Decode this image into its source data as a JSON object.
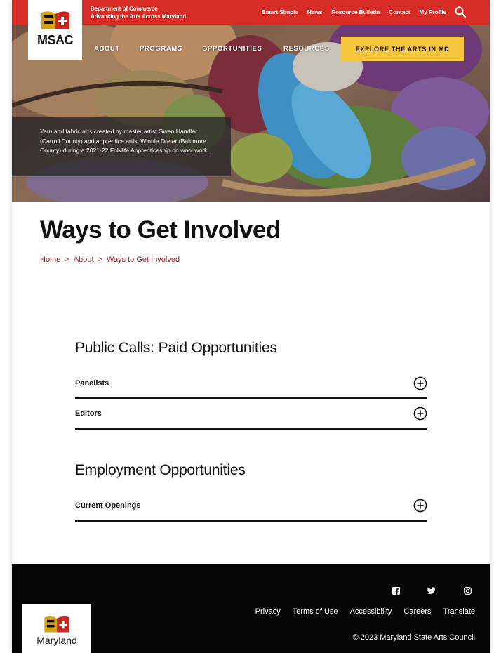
{
  "header": {
    "dept_line1": "Department of Commerce",
    "dept_line2": "Advancing the Arts Across Maryland",
    "utility_links": [
      "Smart Simple",
      "News",
      "Resource Bulletin",
      "Contact",
      "My Profile"
    ],
    "logo_text": "MSAC",
    "nav": [
      "ABOUT",
      "PROGRAMS",
      "OPPORTUNITIES",
      "RESOURCES"
    ],
    "cta_label": "EXPLORE THE ARTS IN MD",
    "colors": {
      "topbar": "#d72b25",
      "cta": "#f5c53b"
    }
  },
  "hero": {
    "caption": "Yarn and fabric arts created by master artist Gwen Handler (Carroll County) and apprentice artist Winnie Dreier (Baltimore County) during a 2021-22 Folklife Apprenticeship on wool work."
  },
  "main": {
    "title": "Ways to Get Involved",
    "breadcrumb": [
      "Home",
      "About",
      "Ways to Get Involved"
    ],
    "breadcrumb_sep": ">",
    "sections": [
      {
        "heading": "Public Calls: Paid Opportunities",
        "items": [
          "Panelists",
          "Editors"
        ]
      },
      {
        "heading": "Employment Opportunities",
        "items": [
          "Current Openings"
        ]
      }
    ],
    "accent": "#a01c1f"
  },
  "footer": {
    "social_icons": [
      "facebook-icon",
      "twitter-icon",
      "instagram-icon"
    ],
    "links": [
      "Privacy",
      "Terms of Use",
      "Accessibility",
      "Careers",
      "Translate"
    ],
    "copyright": "© 2023 Maryland State Arts Council",
    "state_logo_text": "Maryland"
  }
}
